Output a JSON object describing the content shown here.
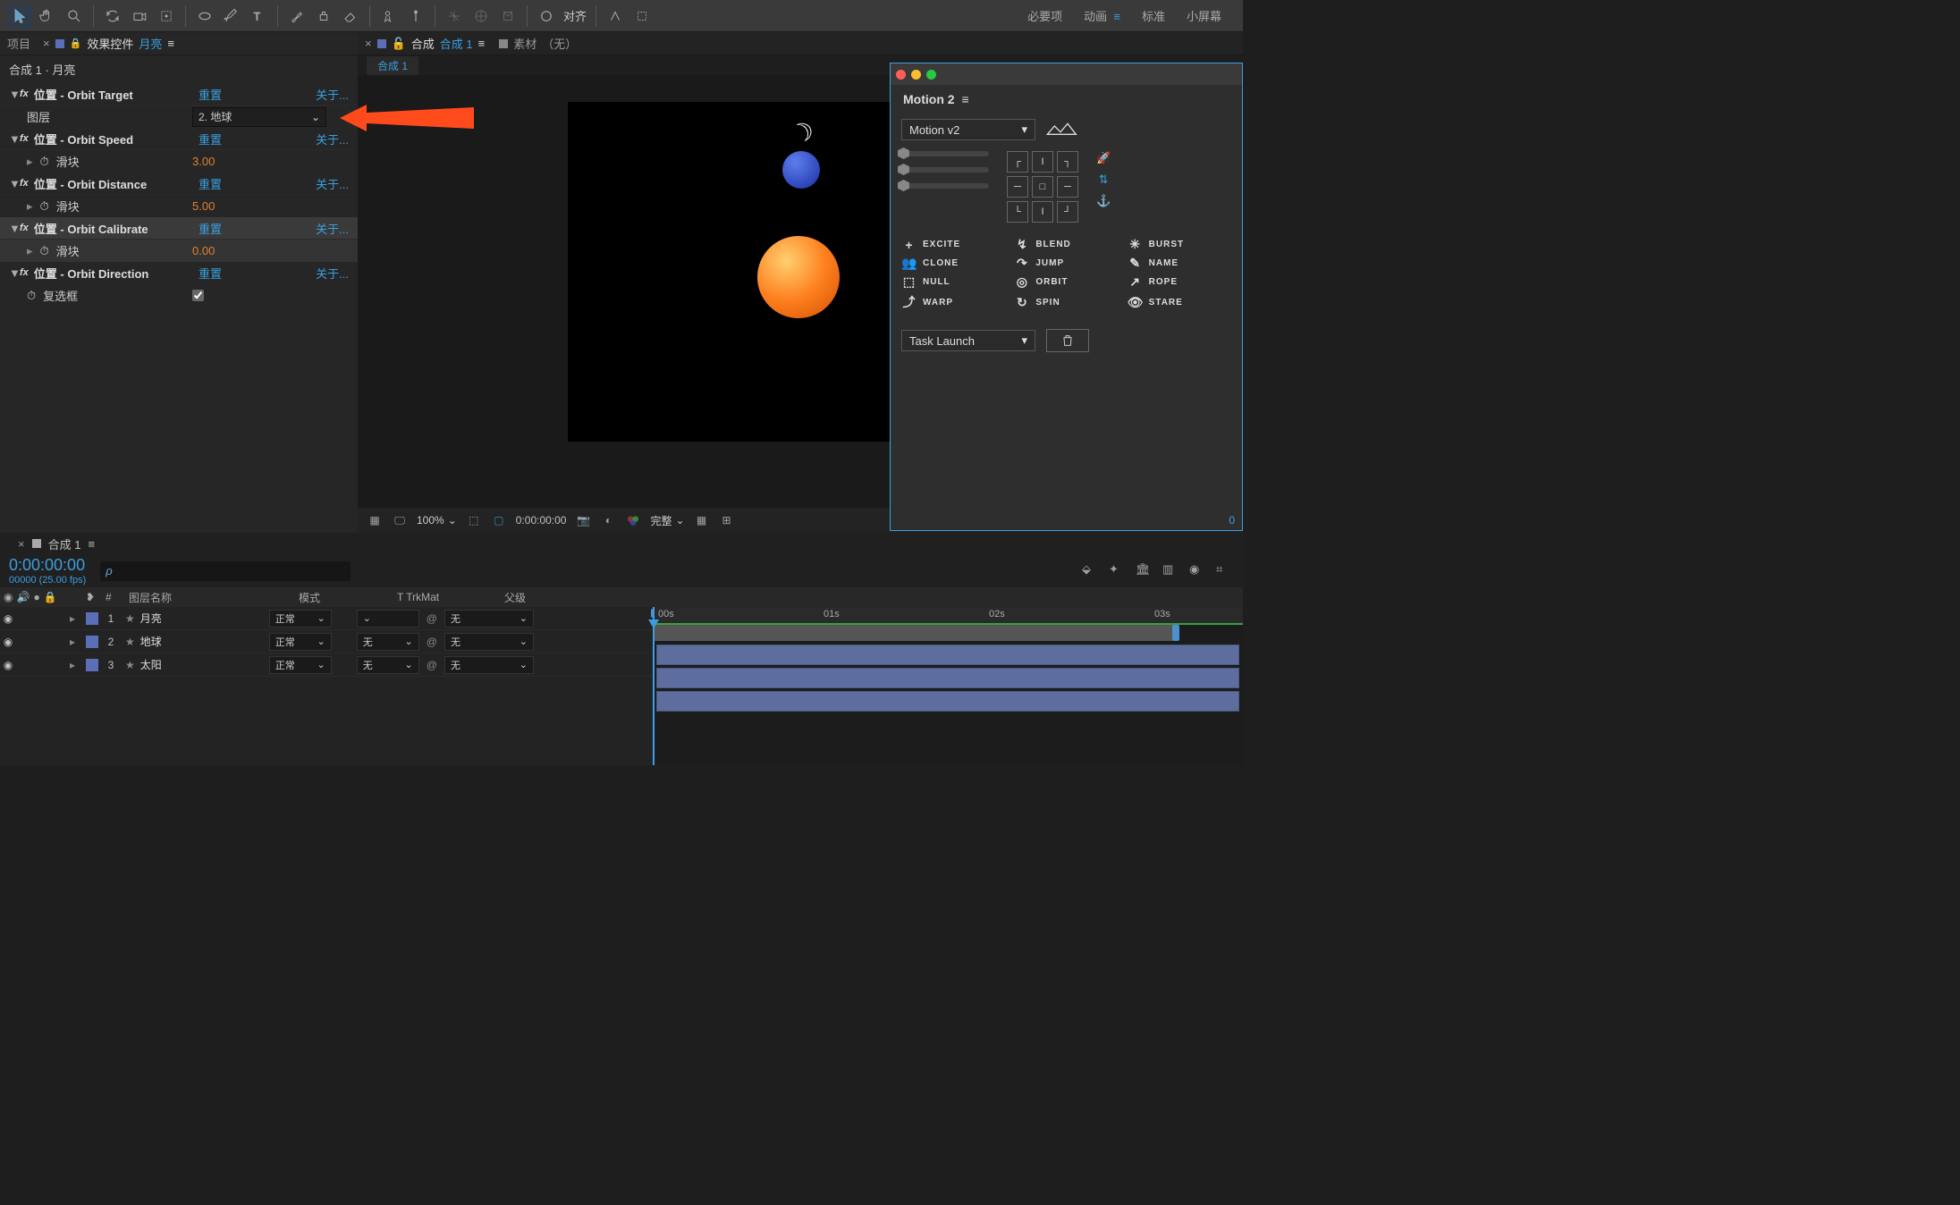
{
  "topbar": {
    "right_tabs": {
      "essentials": "必要项",
      "animation": "动画",
      "standard": "标准",
      "small": "小屏幕"
    },
    "align_label": "对齐"
  },
  "left_panel": {
    "tab_project": "项目",
    "tab_effect_controls": "效果控件",
    "tab_target": "月亮",
    "breadcrumb": "合成 1 · 月亮",
    "effects": [
      {
        "name": "位置 - Orbit Target",
        "reset": "重置",
        "about": "关于...",
        "sub_type": "layer",
        "sub_label": "图层",
        "sub_value": "2. 地球"
      },
      {
        "name": "位置 - Orbit Speed",
        "reset": "重置",
        "about": "关于...",
        "sub_type": "slider",
        "sub_label": "滑块",
        "sub_value": "3.00"
      },
      {
        "name": "位置 - Orbit Distance",
        "reset": "重置",
        "about": "关于...",
        "sub_type": "slider",
        "sub_label": "滑块",
        "sub_value": "5.00"
      },
      {
        "name": "位置 - Orbit Calibrate",
        "reset": "重置",
        "about": "关于...",
        "sub_type": "slider",
        "sub_label": "滑块",
        "sub_value": "0.00",
        "selected": true
      },
      {
        "name": "位置 - Orbit Direction",
        "reset": "重置",
        "about": "关于...",
        "sub_type": "checkbox",
        "sub_label": "复选框",
        "sub_value": "true"
      }
    ]
  },
  "center": {
    "tab_composition_prefix": "合成",
    "tab_composition_name": "合成 1",
    "tab_footage": "素材",
    "tab_footage_none": "（无）",
    "subtab": "合成 1",
    "footer": {
      "zoom": "100%",
      "time": "0:00:00:00",
      "res": "完整"
    }
  },
  "motion_panel": {
    "title": "Motion 2",
    "version": "Motion v2",
    "actions": [
      "EXCITE",
      "BLEND",
      "BURST",
      "CLONE",
      "JUMP",
      "NAME",
      "NULL",
      "ORBIT",
      "ROPE",
      "WARP",
      "SPIN",
      "STARE"
    ],
    "task": "Task Launch",
    "badge": "0"
  },
  "timeline": {
    "tab": "合成 1",
    "time": "0:00:00:00",
    "frame_info": "00000 (25.00 fps)",
    "search_placeholder": "",
    "cols": {
      "num": "#",
      "layer_name": "图层名称",
      "mode": "模式",
      "trkmat": "T  TrkMat",
      "parent": "父级"
    },
    "ruler": [
      "00s",
      "01s",
      "02s",
      "03s"
    ],
    "layers": [
      {
        "num": "1",
        "name": "月亮",
        "mode": "正常",
        "trk": "",
        "parent": "无"
      },
      {
        "num": "2",
        "name": "地球",
        "mode": "正常",
        "trk": "无",
        "parent": "无"
      },
      {
        "num": "3",
        "name": "太阳",
        "mode": "正常",
        "trk": "无",
        "parent": "无"
      }
    ]
  }
}
